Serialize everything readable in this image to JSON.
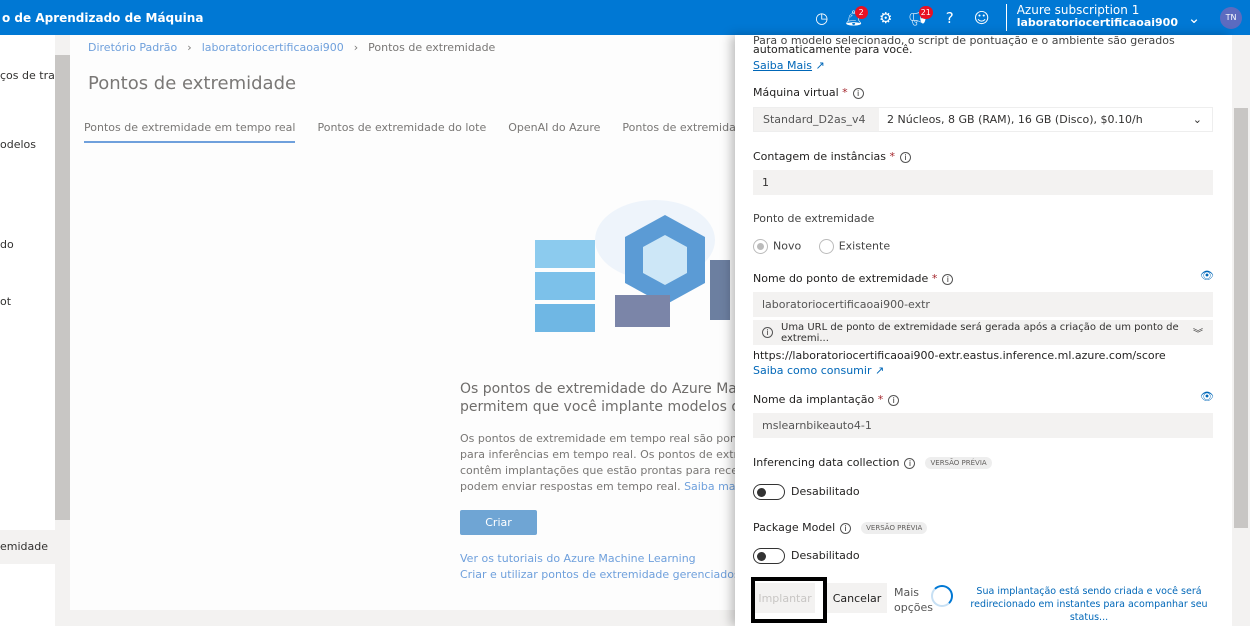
{
  "topbar": {
    "title": "o de Aprendizado de Máquina",
    "notifications_count": "2",
    "feedback_count": "21",
    "subscription": "Azure subscription 1",
    "workspace": "laboratoriocertificaoai900",
    "avatar": "TN",
    "accent": "#0078d4"
  },
  "sidebar": {
    "items": [
      "ços de trab",
      "odelos",
      "do",
      "ot",
      "emidade"
    ]
  },
  "breadcrumb": [
    "Diretório Padrão",
    "laboratoriocertificaoai900",
    "Pontos de extremidade"
  ],
  "page_title": "Pontos de extremidade",
  "tabs": [
    "Pontos de extremidade em tempo real",
    "Pontos de extremidade do lote",
    "OpenAI do Azure",
    "Pontos de extremidade sem"
  ],
  "empty": {
    "heading1": "Os pontos de extremidade do Azure Machin",
    "heading2": "permitem que você implante modelos de ma",
    "p1": "Os pontos de extremidade em tempo real são pontos",
    "p2": "para inferências em tempo real. Os pontos de extremi",
    "p3": "contêm implantações que estão prontas para receber",
    "p4": "podem enviar respostas em tempo real.",
    "learn_more": "Saiba mais",
    "create": "Criar",
    "link1": "Ver os tutoriais do Azure Machine Learning",
    "link2": "Criar e utilizar pontos de extremidade gerenciados no"
  },
  "panel": {
    "intro1": "Para o modelo selecionado, o script de pontuação e o ambiente são gerados",
    "intro2": "automaticamente para você.",
    "learn_more": "Saiba Mais",
    "vm_label": "Máquina virtual",
    "vm_size": "Standard_D2as_v4",
    "vm_desc": "2 Núcleos, 8 GB (RAM), 16 GB (Disco), $0.10/h",
    "instances_label": "Contagem de instâncias",
    "instances": "1",
    "endpoint_label": "Ponto de extremidade",
    "radio_new": "Novo",
    "radio_existing": "Existente",
    "endpoint_selected": "Novo",
    "endpoint_name_label": "Nome do ponto de extremidade",
    "endpoint_name": "laboratoriocertificaoai900-extr",
    "url_info": "Uma URL de ponto de extremidade será gerada após a criação de um ponto de extremi...",
    "url": "https://laboratoriocertificaoai900-extr.eastus.inference.ml.azure.com/score",
    "consume_link": "Saiba como consumir",
    "deployment_label": "Nome da implantação",
    "deployment": "mslearnbikeauto4-1",
    "idc_label": "Inferencing data collection",
    "preview": "VERSÃO PRÉVIA",
    "idc_state": "Desabilitado",
    "pkg_label": "Package Model",
    "pkg_state": "Desabilitado",
    "deploy": "Implantar",
    "cancel": "Cancelar",
    "more1": "Mais",
    "more2": "opções",
    "status1": "Sua implantação está sendo criada e você será",
    "status2": "redirecionado em instantes para acompanhar seu status..."
  }
}
